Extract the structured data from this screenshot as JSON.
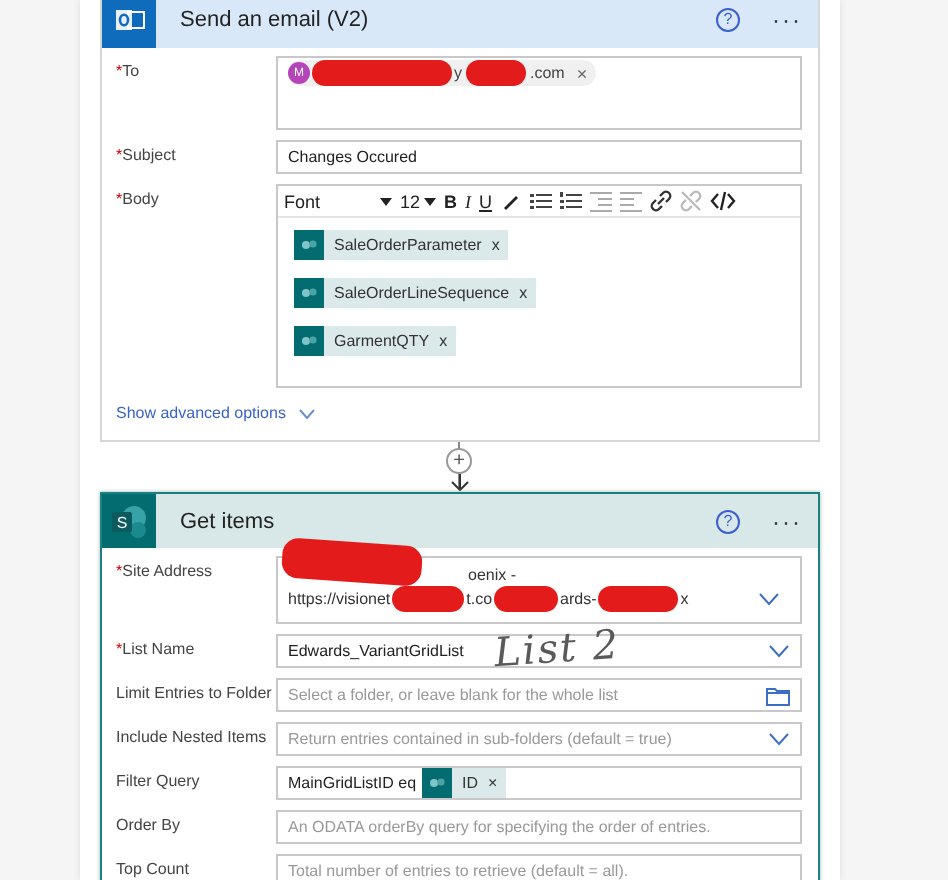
{
  "email_card": {
    "title": "Send an email (V2)",
    "help": "?",
    "menu": "···",
    "to": {
      "label": "To",
      "required_mark": "*",
      "avatar": "M",
      "fragments": [
        "y",
        ".com"
      ],
      "remove": "×"
    },
    "subject": {
      "label": "Subject",
      "required_mark": "*",
      "value": "Changes Occured"
    },
    "body": {
      "label": "Body",
      "required_mark": "*",
      "font": "Font",
      "size": "12",
      "format": [
        "B",
        "I",
        "U"
      ],
      "tokens": [
        {
          "text": "SaleOrderParameter",
          "remove": "x"
        },
        {
          "text": "SaleOrderLineSequence",
          "remove": "x"
        },
        {
          "text": "GarmentQTY",
          "remove": "x"
        }
      ]
    },
    "advanced": "Show advanced options"
  },
  "add_step": "+",
  "items_card": {
    "title": "Get items",
    "help": "?",
    "menu": "···",
    "icon_letter": "S",
    "fields": [
      {
        "kind": "site",
        "label": "Site Address",
        "required_mark": "*",
        "line_1": "oenix -",
        "line_2": [
          "https://visionet",
          "t.co",
          "ards-",
          "x"
        ]
      },
      {
        "kind": "dropdown",
        "label": "List Name",
        "required_mark": "*",
        "value": "Edwards_VariantGridList"
      },
      {
        "kind": "folder",
        "label": "Limit Entries to Folder",
        "placeholder": "Select a folder, or leave blank for the whole list"
      },
      {
        "kind": "dropdown",
        "label": "Include Nested Items",
        "placeholder": "Return entries contained in sub-folders (default = true)"
      },
      {
        "kind": "filter",
        "label": "Filter Query",
        "value": "MainGridListID eq",
        "token": "ID",
        "remove": "×"
      },
      {
        "kind": "text",
        "label": "Order By",
        "placeholder": "An ODATA orderBy query for specifying the order of entries."
      },
      {
        "kind": "text",
        "label": "Top Count",
        "placeholder": "Total number of entries to retrieve (default = all)."
      }
    ]
  },
  "annotation": "List 2"
}
